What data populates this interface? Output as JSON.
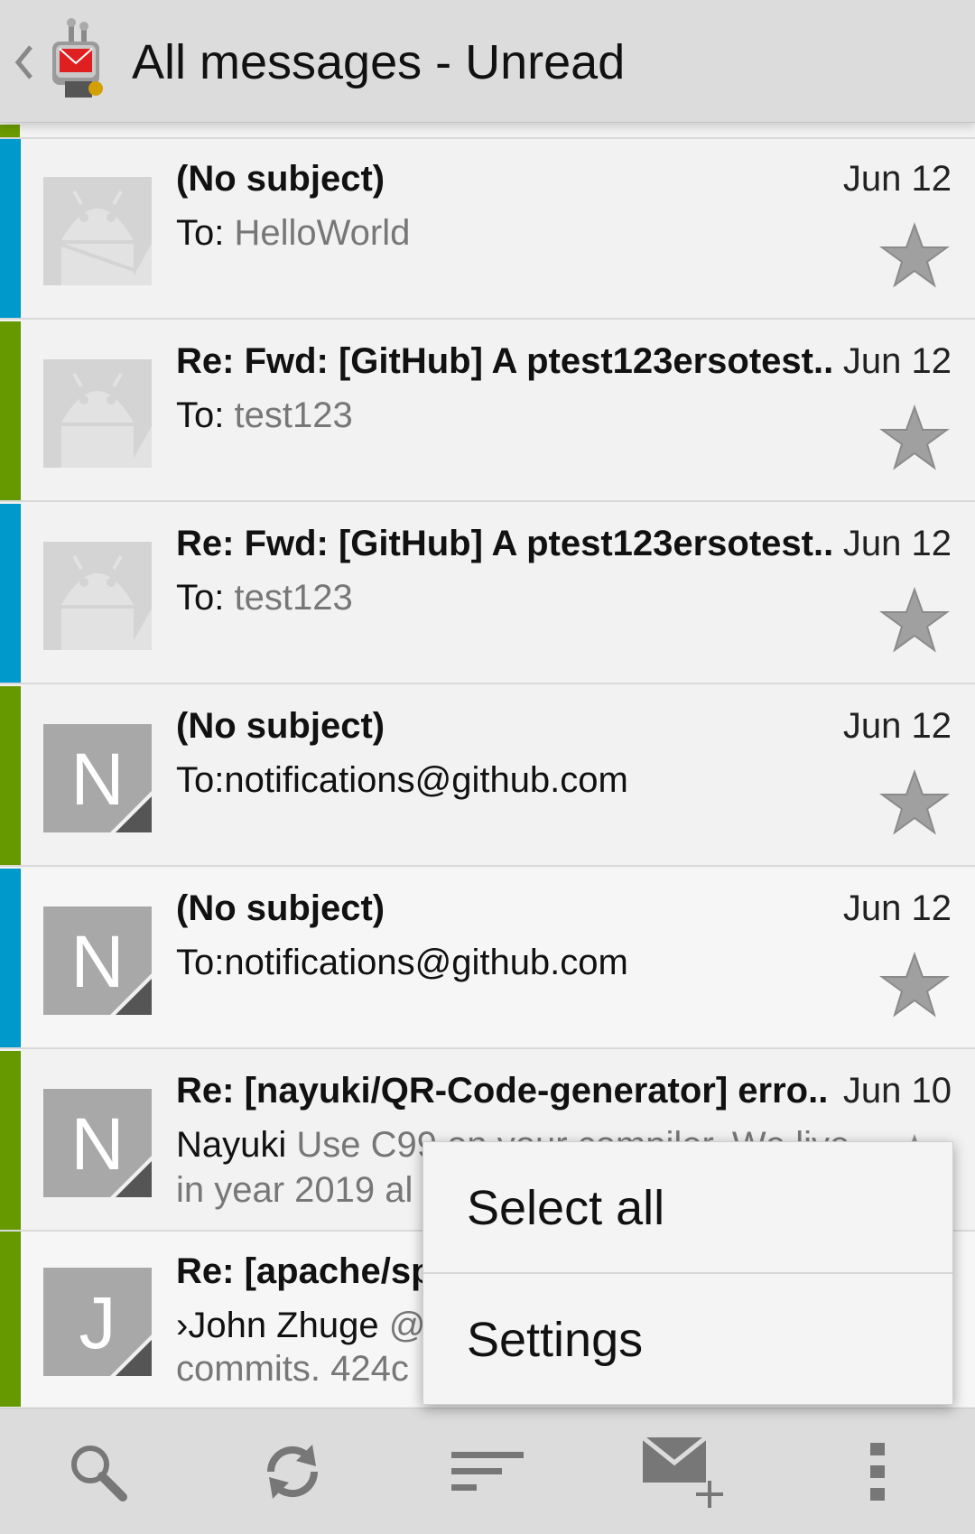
{
  "header": {
    "title": "All messages - Unread",
    "app_icon": "mail-robot-logo-icon",
    "up_icon": "chevron-left-icon"
  },
  "colors": {
    "accent_blue": "#0099cc",
    "accent_green": "#669900",
    "star": "#a0a0a0"
  },
  "messages": [
    {
      "subject": "(No subject)",
      "date": "Jun 12",
      "to_label": "To: ",
      "to_value": "HelloWorld",
      "accent": "blue",
      "avatar": "android"
    },
    {
      "subject": "Re: Fwd: [GitHub] A ptest123ersotest..",
      "date": "Jun 12",
      "to_label": "To: ",
      "to_value": "test123",
      "accent": "green",
      "avatar": "android"
    },
    {
      "subject": "Re: Fwd: [GitHub] A ptest123ersotest..",
      "date": "Jun 12",
      "to_label": "To: ",
      "to_value": "test123",
      "accent": "blue",
      "avatar": "android"
    },
    {
      "subject": "(No subject)",
      "date": "Jun 12",
      "to_label": "To:",
      "to_value": "notifications@github.com",
      "accent": "green",
      "avatar": "N"
    },
    {
      "subject": "(No subject)",
      "date": "Jun 12",
      "to_label": "To:",
      "to_value": "notifications@github.com",
      "accent": "blue",
      "avatar": "N"
    },
    {
      "subject": "Re: [nayuki/QR-Code-generator] erro..",
      "date": "Jun 10",
      "sender": "Nayuki ",
      "preview": "Use C99 on your compiler. We live",
      "preview2": "in year 2019 al",
      "accent": "green",
      "avatar": "N"
    },
    {
      "subject": "Re: [apache/sp",
      "sender": "›John Zhuge ",
      "preview": "@",
      "preview2": "commits. 424c",
      "accent": "green",
      "avatar": "J"
    }
  ],
  "menu": {
    "items": [
      "Select all",
      "Settings"
    ]
  },
  "bottom_bar": {
    "buttons": [
      "search-icon",
      "refresh-icon",
      "sort-icon",
      "compose-mail-icon",
      "overflow-menu-icon"
    ]
  }
}
